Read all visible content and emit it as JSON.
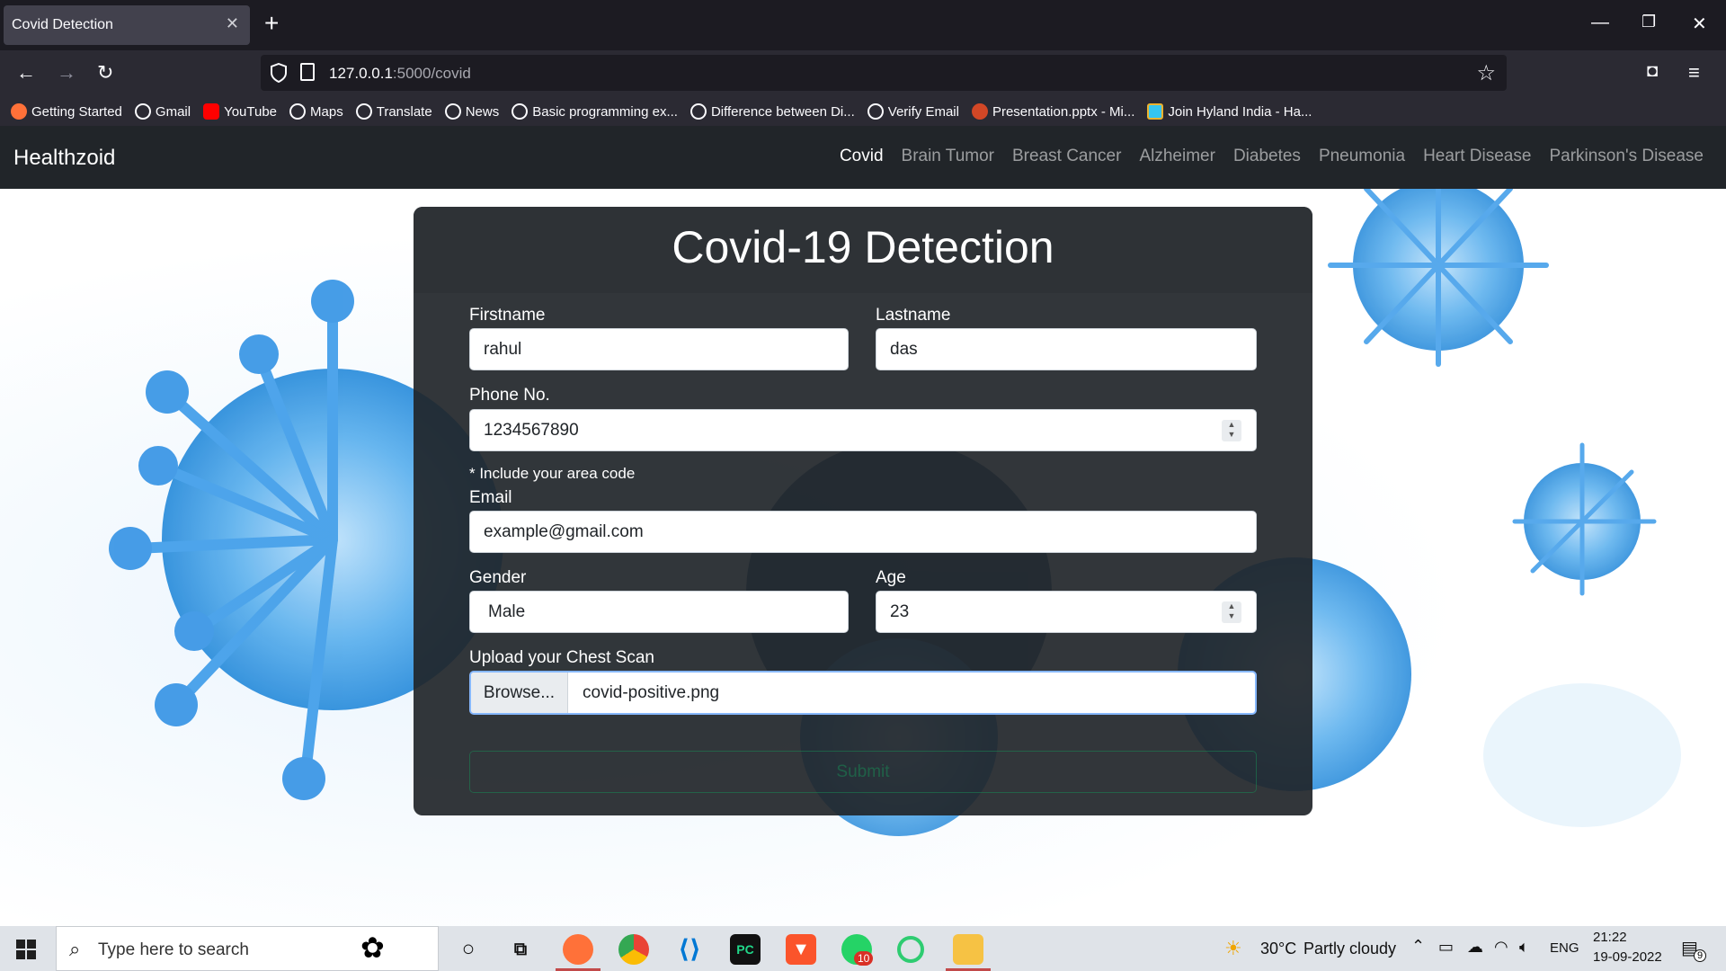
{
  "browser": {
    "tab_title": "Covid Detection",
    "url_host": "127.0.0.1",
    "url_path": ":5000/covid",
    "bookmarks": [
      {
        "label": "Getting Started",
        "color": "#ff7139"
      },
      {
        "label": "Gmail",
        "color": "#fbfbfe"
      },
      {
        "label": "YouTube",
        "color": "#ff0000"
      },
      {
        "label": "Maps",
        "color": "#fbfbfe"
      },
      {
        "label": "Translate",
        "color": "#fbfbfe"
      },
      {
        "label": "News",
        "color": "#fbfbfe"
      },
      {
        "label": "Basic programming ex...",
        "color": "#fbfbfe"
      },
      {
        "label": "Difference between Di...",
        "color": "#fbfbfe"
      },
      {
        "label": "Verify Email",
        "color": "#fbfbfe"
      },
      {
        "label": "Presentation.pptx - Mi...",
        "color": "#d24726"
      },
      {
        "label": "Join Hyland India - Ha...",
        "color": "#36c5f0"
      }
    ]
  },
  "site": {
    "brand": "Healthzoid",
    "nav": [
      "Covid",
      "Brain Tumor",
      "Breast Cancer",
      "Alzheimer",
      "Diabetes",
      "Pneumonia",
      "Heart Disease",
      "Parkinson's Disease"
    ],
    "active_nav": "Covid"
  },
  "form": {
    "title": "Covid-19 Detection",
    "firstname_label": "Firstname",
    "firstname_value": "rahul",
    "lastname_label": "Lastname",
    "lastname_value": "das",
    "phone_label": "Phone No.",
    "phone_value": "1234567890",
    "phone_hint": "* Include your area code",
    "email_label": "Email",
    "email_value": "example@gmail.com",
    "gender_label": "Gender",
    "gender_value": "Male",
    "age_label": "Age",
    "age_value": "23",
    "upload_label": "Upload your Chest Scan",
    "browse_label": "Browse...",
    "file_name": "covid-positive.png",
    "submit_label": "Submit"
  },
  "taskbar": {
    "search_placeholder": "Type here to search",
    "weather_temp": "30°C",
    "weather_desc": "Partly cloudy",
    "language": "ENG",
    "time": "21:22",
    "date": "19-09-2022",
    "whatsapp_badge": "10",
    "notification_count": "9"
  }
}
